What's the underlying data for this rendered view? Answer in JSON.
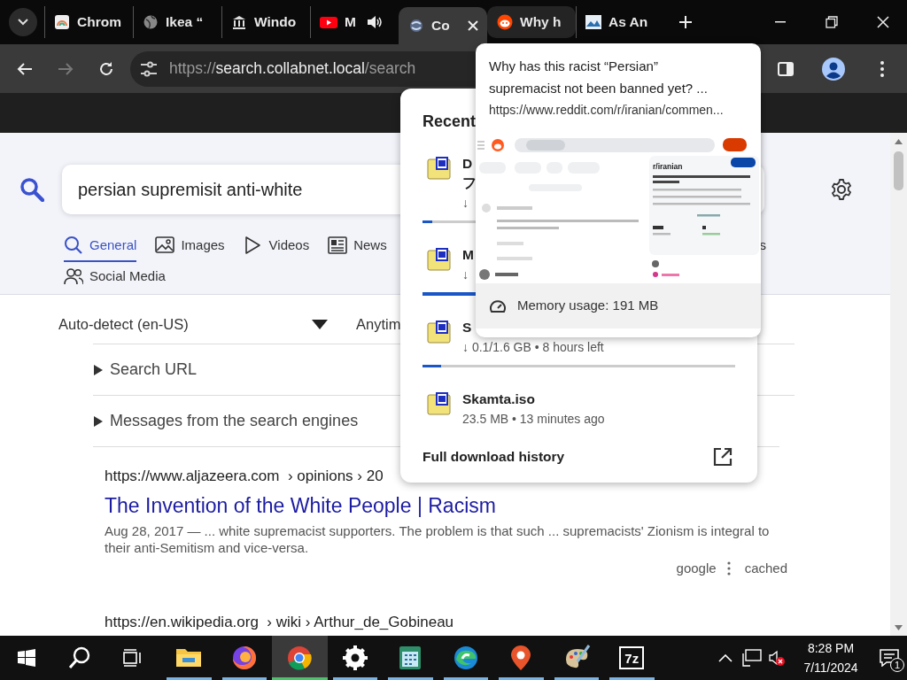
{
  "tabs": [
    {
      "title": "Chrom",
      "selected": false,
      "hovered": false,
      "audio": false
    },
    {
      "title": "Ikea “",
      "selected": false,
      "hovered": false,
      "audio": false
    },
    {
      "title": "Windo",
      "selected": false,
      "hovered": false,
      "audio": false
    },
    {
      "title": "M",
      "selected": false,
      "hovered": false,
      "audio": true
    },
    {
      "title": "Co",
      "selected": true,
      "hovered": false,
      "audio": false
    },
    {
      "title": "Why h",
      "selected": false,
      "hovered": true,
      "audio": false
    },
    {
      "title": "As An",
      "selected": false,
      "hovered": false,
      "audio": false
    }
  ],
  "toolbar": {
    "back_disabled": false,
    "forward_disabled": true,
    "address": {
      "scheme": "https://",
      "host": "search.collabnet.local",
      "path": "/search"
    }
  },
  "search": {
    "query": "persian supremisit anti-white",
    "categories": [
      {
        "label": "General",
        "selected": true
      },
      {
        "label": "Images",
        "selected": false
      },
      {
        "label": "Videos",
        "selected": false
      },
      {
        "label": "News",
        "selected": false
      },
      {
        "label": "s",
        "selected": false
      },
      {
        "label": "Social Media",
        "selected": false
      }
    ],
    "language": "Auto-detect (en-US)",
    "time_range": "Anytim",
    "sections": [
      {
        "label": "Search URL",
        "expanded": false
      },
      {
        "label": "Messages from the search engines",
        "expanded": false
      }
    ],
    "results": [
      {
        "url": "https://www.aljazeera.com",
        "breadcrumb": "› opinions › 20",
        "title": "The Invention of the White People | Racism",
        "snippet": "Aug 28, 2017 — ... white supremacist supporters. The problem is that such ... supremacists' Zionism is integral to their anti-Semitism and vice-versa.",
        "engine": "google",
        "cached": "cached"
      },
      {
        "url": "https://en.wikipedia.org",
        "breadcrumb": "› wiki › Arthur_de_Gobineau"
      }
    ]
  },
  "downloads": {
    "title": "Recent",
    "items": [
      {
        "name": "D",
        "name_continued": "フ",
        "status": "↓",
        "level": 0.03
      },
      {
        "name": "M",
        "status": "↓",
        "level": 0.2
      },
      {
        "name": "S",
        "status": "↓ 0.1/1.6 GB • 8 hours left",
        "level": 0.06
      },
      {
        "name": "Skamta.iso",
        "status": "23.5 MB • 13 minutes ago"
      }
    ],
    "footer": "Full download history"
  },
  "tab_preview": {
    "title": "Why has this racist “Persian” supremacist not been banned yet? ...",
    "url": "https://www.reddit.com/r/iranian/commen...",
    "subreddit": "r/iranian",
    "memory": "Memory usage: 191 MB"
  },
  "taskbar": {
    "apps": [
      {
        "running": true,
        "selected": false
      },
      {
        "running": true,
        "selected": false
      },
      {
        "running": true,
        "selected": true
      },
      {
        "running": true,
        "selected": false
      },
      {
        "running": true,
        "selected": false
      },
      {
        "running": true,
        "selected": false
      },
      {
        "running": true,
        "selected": false
      },
      {
        "running": true,
        "selected": false
      },
      {
        "running": true,
        "selected": false,
        "label": "7z"
      }
    ],
    "volume_muted": true,
    "time": "8:28 PM",
    "date": "7/11/2024",
    "notifications": "1"
  }
}
